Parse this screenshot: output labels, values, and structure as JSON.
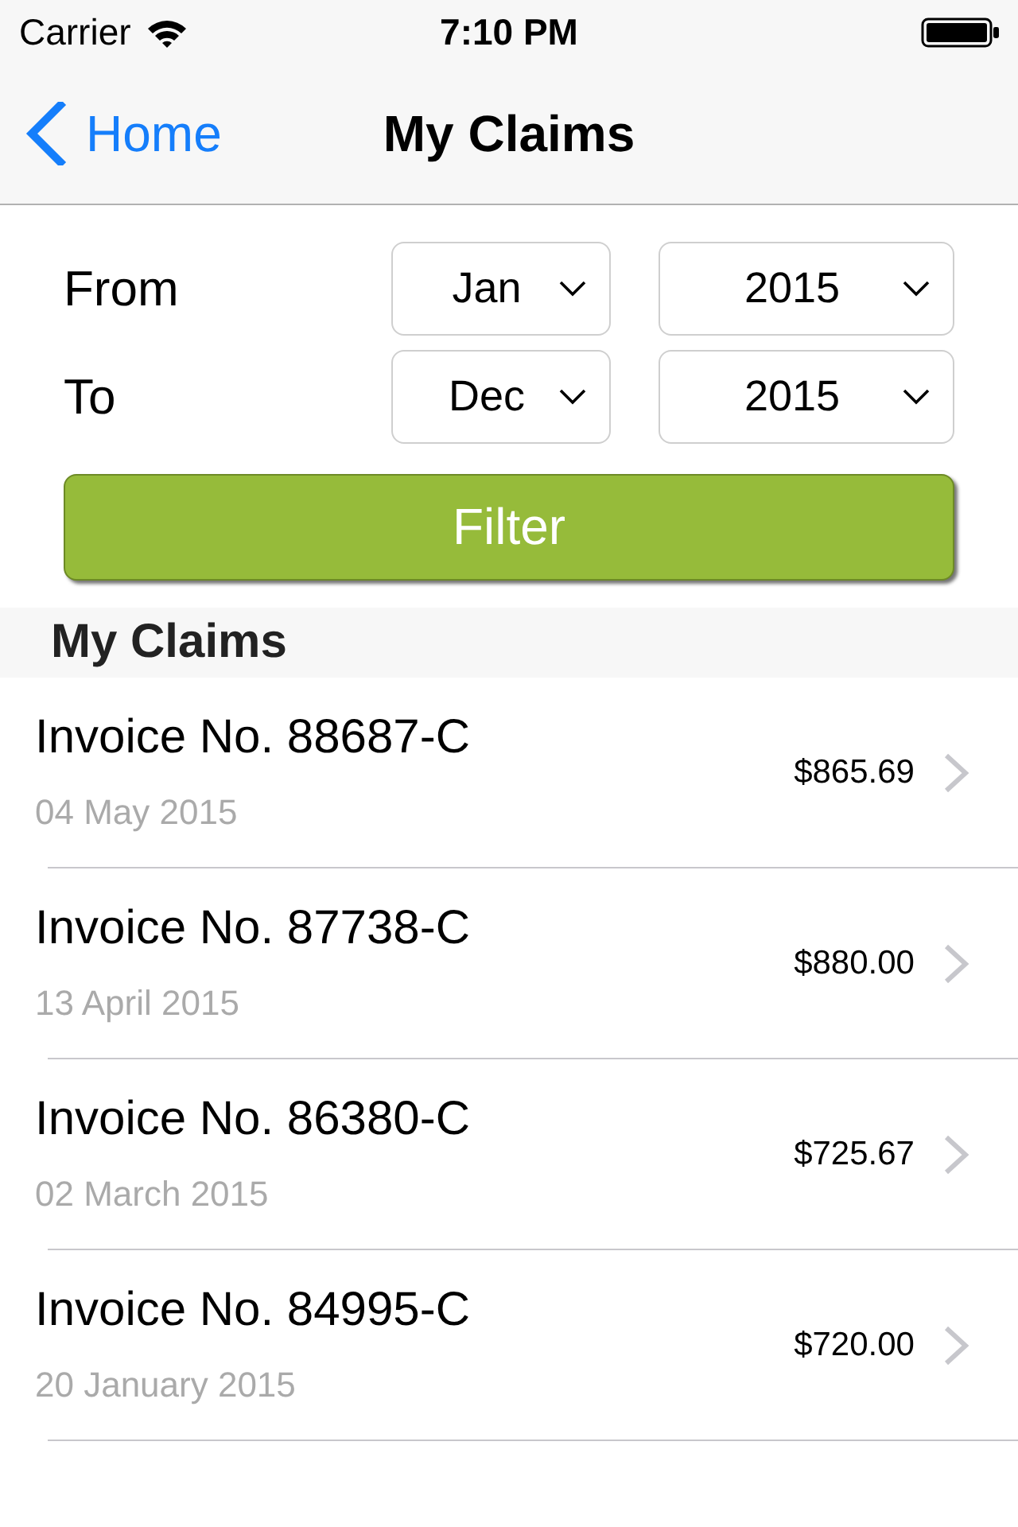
{
  "status_bar": {
    "carrier": "Carrier",
    "time": "7:10 PM"
  },
  "nav_bar": {
    "back": "Home",
    "title": "My Claims"
  },
  "filter": {
    "rows": [
      {
        "label": "From",
        "month": "Jan",
        "year": "2015"
      },
      {
        "label": "To",
        "month": "Dec",
        "year": "2015"
      }
    ],
    "button": "Filter"
  },
  "claims": {
    "header": "My Claims",
    "items": [
      {
        "title": "Invoice No. 88687-C",
        "date": "04 May 2015",
        "amount": "$865.69"
      },
      {
        "title": "Invoice No. 87738-C",
        "date": "13 April 2015",
        "amount": "$880.00"
      },
      {
        "title": "Invoice No. 86380-C",
        "date": "02 March 2015",
        "amount": "$725.67"
      },
      {
        "title": "Invoice No. 84995-C",
        "date": "20 January 2015",
        "amount": "$720.00"
      }
    ]
  }
}
